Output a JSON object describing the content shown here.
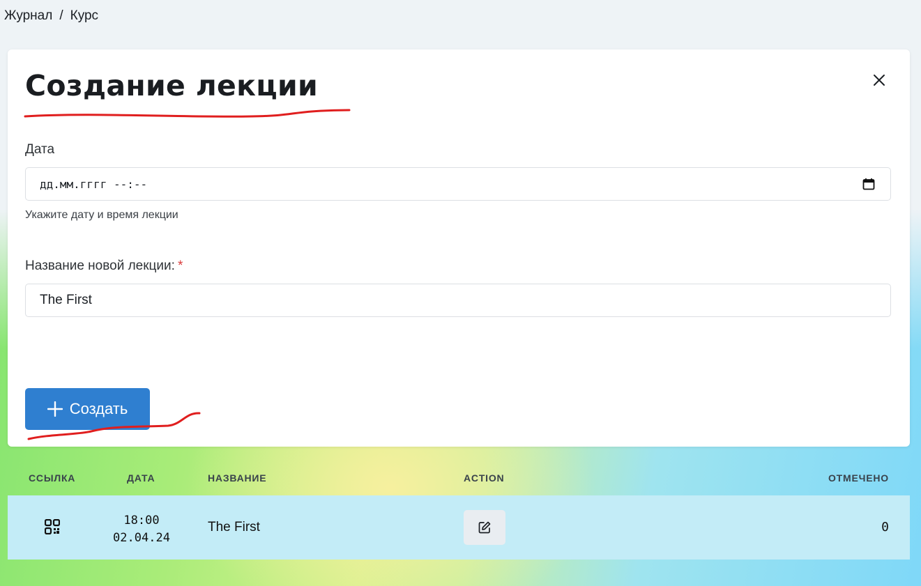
{
  "breadcrumb": {
    "items": [
      "Журнал",
      "Курс"
    ],
    "separator": "/"
  },
  "modal": {
    "title": "Создание лекции",
    "date_label": "Дата",
    "date_placeholder": "дд.мм.гггг --:--",
    "date_hint": "Укажите дату и время лекции",
    "name_label": "Название новой лекции:",
    "required_mark": "*",
    "name_value": "The First",
    "create_button": "Создать",
    "close_icon": "close-icon"
  },
  "table": {
    "headers": {
      "link": "ССЫЛКА",
      "date": "ДАТА",
      "name": "НАЗВАНИЕ",
      "action": "ACTION",
      "marked": "ОТМЕЧЕНО"
    },
    "rows": [
      {
        "link_icon": "qr-code-icon",
        "time": "18:00",
        "date": "02.04.24",
        "name": "The First",
        "action_icon": "edit-icon",
        "marked": "0"
      }
    ]
  },
  "colors": {
    "primary": "#2f7fd0",
    "row_bg": "#c3ecf7",
    "annotation": "#e01e1e",
    "required": "#d93a3a"
  }
}
